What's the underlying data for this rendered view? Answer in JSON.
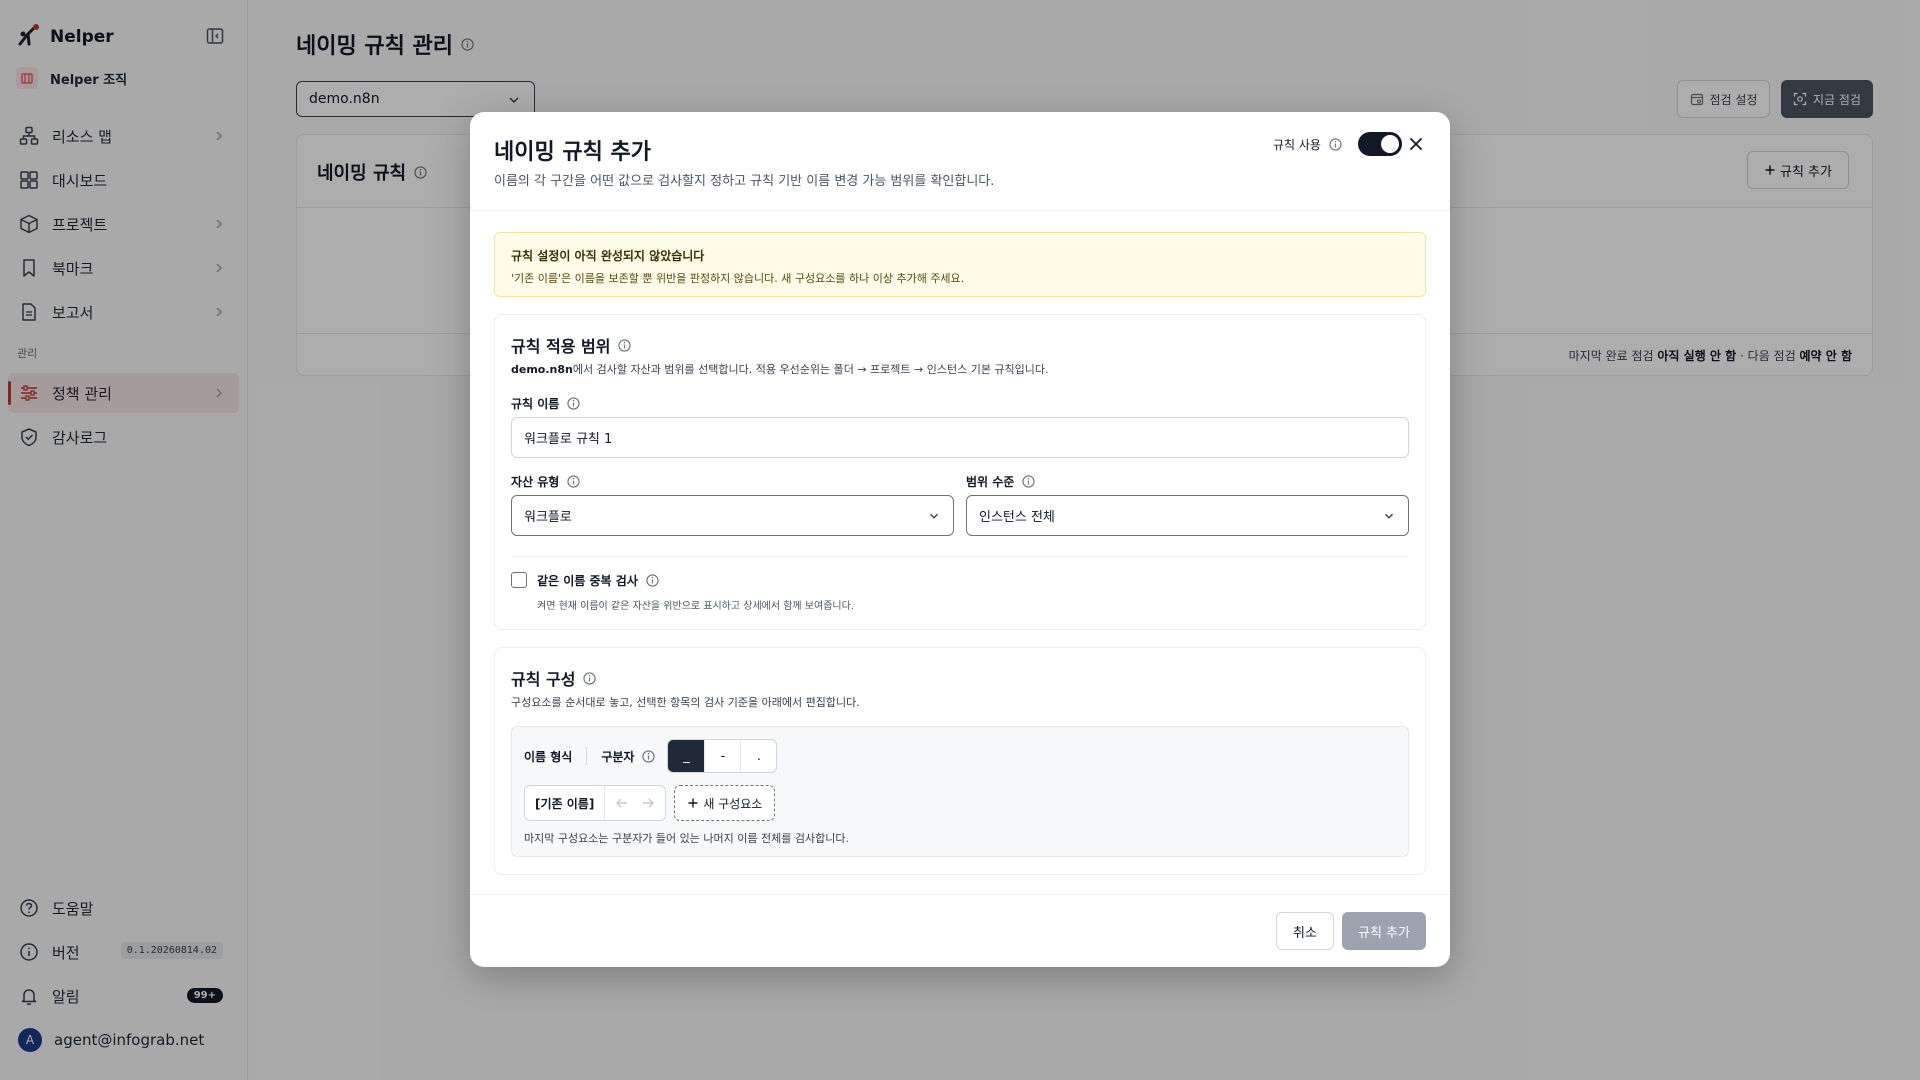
{
  "sidebar": {
    "brand": "Nelper",
    "org_name": "Nelper 조직",
    "nav": [
      {
        "label": "리소스 맵",
        "icon": "resource-map-icon"
      },
      {
        "label": "대시보드",
        "icon": "dashboard-icon"
      },
      {
        "label": "프로젝트",
        "icon": "project-icon"
      },
      {
        "label": "북마크",
        "icon": "bookmark-icon"
      },
      {
        "label": "보고서",
        "icon": "report-icon"
      }
    ],
    "section_label": "관리",
    "admin_nav": [
      {
        "label": "정책 관리",
        "icon": "policy-icon",
        "active": true
      },
      {
        "label": "감사로그",
        "icon": "audit-log-icon"
      }
    ],
    "bottom": {
      "help": "도움말",
      "version_label": "버전",
      "version_value": "0.1.20260814.02",
      "alerts_label": "알림",
      "alerts_count": "99+",
      "user_initial": "A",
      "user_email": "agent@infograb.net"
    }
  },
  "main": {
    "title": "네이밍 규칙 관리",
    "instance": "demo.n8n",
    "btn_check_settings": "점검 설정",
    "btn_check_now": "지금 점검",
    "card_title": "네이밍 규칙",
    "btn_add_rule": "규칙 추가",
    "footer": {
      "prefix": "마지막 완료 점검",
      "last_value": "아직 실행 안 함",
      "sep": "·",
      "next_label": "다음 점검",
      "next_value": "예약 안 함"
    }
  },
  "modal": {
    "title": "네이밍 규칙 추가",
    "subtitle": "이름의 각 구간을 어떤 값으로 검사할지 정하고 규칙 기반 이름 변경 가능 범위를 확인합니다.",
    "toggle_label": "규칙 사용",
    "toggle_on": true,
    "warning": {
      "title": "규칙 설정이 아직 완성되지 않았습니다",
      "text": "'기존 이름'은 이름을 보존할 뿐 위반을 판정하지 않습니다. 새 구성요소를 하나 이상 추가해 주세요."
    },
    "scope": {
      "title": "규칙 적용 범위",
      "desc_instance": "demo.n8n",
      "desc_rest": "에서 검사할 자산과 범위를 선택합니다. 적용 우선순위는 폴더 → 프로젝트 → 인스턴스 기본 규칙입니다.",
      "name_label": "규칙 이름",
      "name_value": "워크플로 규칙 1",
      "asset_label": "자산 유형",
      "asset_value": "워크플로",
      "level_label": "범위 수준",
      "level_value": "인스턴스 전체",
      "dup_label": "같은 이름 중복 검사",
      "dup_help": "켜면 현재 이름이 같은 자산을 위반으로 표시하고 상세에서 함께 보여줍니다.",
      "dup_checked": false
    },
    "composition": {
      "title": "규칙 구성",
      "desc": "구성요소를 순서대로 놓고, 선택한 항목의 검사 기준을 아래에서 편집합니다.",
      "format_label": "이름 형식",
      "separator_label": "구분자",
      "separators": [
        "_",
        "-",
        "."
      ],
      "selected_separator": "_",
      "chip_label": "[기존 이름]",
      "new_component": "새 구성요소",
      "help": "마지막 구성요소는 구분자가 들어 있는 나머지 이름 전체를 검사합니다."
    },
    "btn_cancel": "취소",
    "btn_submit": "규칙 추가"
  }
}
